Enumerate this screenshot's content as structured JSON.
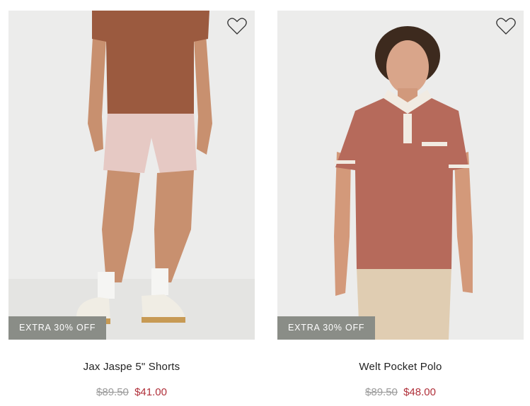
{
  "products": [
    {
      "name": "Jax Jaspe 5\" Shorts",
      "badge": "EXTRA 30% OFF",
      "original_price": "$89.50",
      "sale_price": "$41.00",
      "wishlist_icon": "heart-outline-icon"
    },
    {
      "name": "Welt Pocket Polo",
      "badge": "EXTRA 30% OFF",
      "original_price": "$89.50",
      "sale_price": "$48.00",
      "wishlist_icon": "heart-outline-icon"
    }
  ],
  "colors": {
    "badge_bg": "#8a8d87",
    "sale_price": "#b0303a",
    "original_price": "#9a9a9a",
    "image_bg": "#ececeb"
  }
}
